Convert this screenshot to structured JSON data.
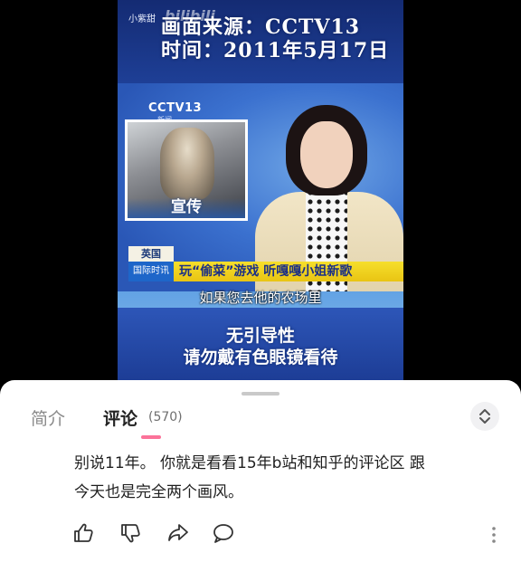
{
  "video": {
    "uploader": "小紫甜",
    "watermark": "bilibili",
    "source_line1": "画面来源：CCTV13",
    "source_line2": "时间：2011年5月17日",
    "channel_logo": "CCTV13",
    "channel_sub": "新闻",
    "inset_caption": "宣传",
    "region_tag": "英国",
    "program_tag": "国际时讯",
    "headline": "玩“偷菜”游戏 听嘎嘎小姐新歌",
    "subtitle": "如果您去他的农场里",
    "notice_line1": "无引导性",
    "notice_line2": "请勿戴有色眼镜看待"
  },
  "tabs": {
    "intro_label": "简介",
    "comments_label": "评论",
    "comments_count": "(570)",
    "accent_color": "#fb7299"
  },
  "sort_button_icon": "sort-toggle-icon",
  "comment": {
    "line1": "别说11年。 你就是看看15年b站和知乎的评论区 跟",
    "line2": "今天也是完全两个画风。"
  },
  "comment_actions": [
    {
      "name": "like",
      "icon": "thumbs-up-icon"
    },
    {
      "name": "dislike",
      "icon": "thumbs-down-icon"
    },
    {
      "name": "share",
      "icon": "share-icon"
    },
    {
      "name": "reply",
      "icon": "reply-bubble-icon"
    }
  ]
}
